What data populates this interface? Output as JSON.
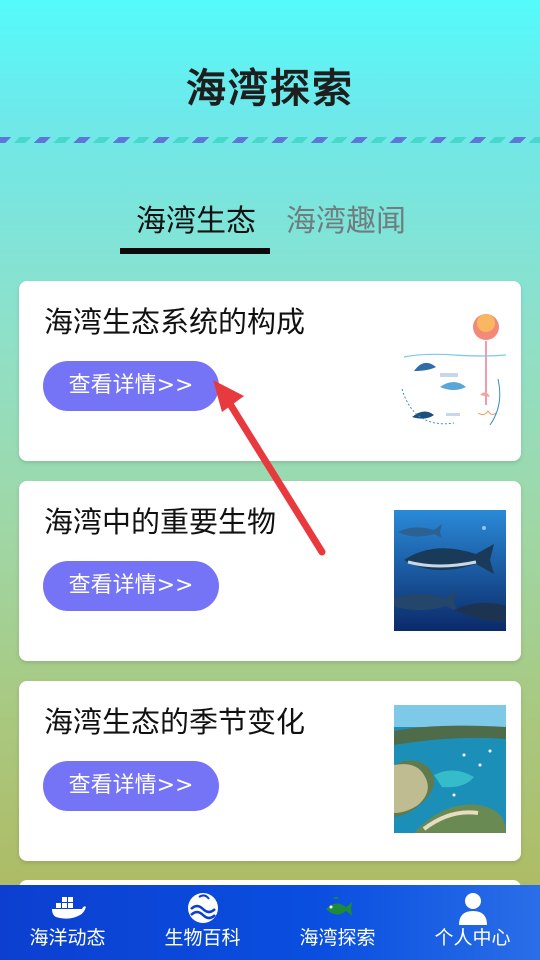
{
  "header": {
    "title": "海湾探索"
  },
  "tabs": [
    {
      "label": "海湾生态",
      "active": true
    },
    {
      "label": "海湾趣闻",
      "active": false
    }
  ],
  "cards": [
    {
      "title": "海湾生态系统的构成",
      "button": "查看详情>>",
      "image": "bay-ecosystem-diagram"
    },
    {
      "title": "海湾中的重要生物",
      "button": "查看详情>>",
      "image": "tuna-fish-photo"
    },
    {
      "title": "海湾生态的季节变化",
      "button": "查看详情>>",
      "image": "bay-aerial-photo"
    }
  ],
  "tabbar": [
    {
      "label": "海洋动态",
      "icon": "whale-ship-icon"
    },
    {
      "label": "生物百科",
      "icon": "wave-globe-icon"
    },
    {
      "label": "海湾探索",
      "icon": "fish-icon"
    },
    {
      "label": "个人中心",
      "icon": "user-icon"
    }
  ],
  "colors": {
    "accent_button": "#7674f6",
    "tabbar_bg": "#0c3fd0",
    "annotation_arrow": "#e8393e"
  }
}
